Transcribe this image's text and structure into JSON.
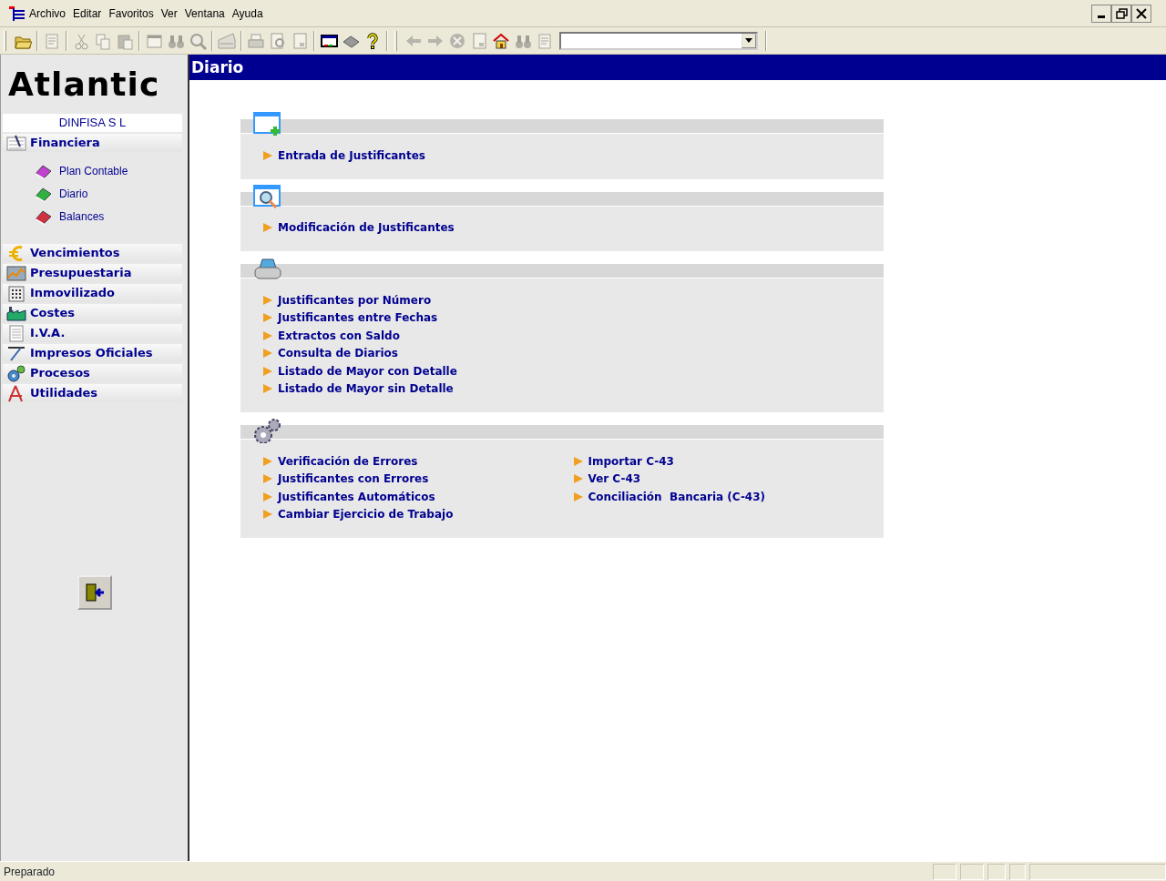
{
  "menu": [
    {
      "label": "Archivo"
    },
    {
      "label": "Editar"
    },
    {
      "label": "Favoritos"
    },
    {
      "label": "Ver"
    },
    {
      "label": "Ventana"
    },
    {
      "label": "Ayuda"
    }
  ],
  "toolbar": [
    [
      {
        "disabled": false
      }
    ],
    [
      {
        "disabled": true
      }
    ],
    [
      {
        "disabled": true
      },
      {
        "disabled": true
      },
      {
        "disabled": true
      }
    ],
    [
      {
        "disabled": true
      },
      {
        "disabled": true
      },
      {
        "disabled": true
      }
    ],
    [
      {
        "disabled": true
      }
    ],
    [
      {
        "disabled": true
      },
      {
        "disabled": true
      },
      {
        "disabled": true
      }
    ],
    [
      {
        "disabled": false
      },
      {
        "disabled": false
      },
      {
        "disabled": false
      }
    ],
    [
      {
        "disabled": true
      },
      {
        "disabled": true
      },
      {
        "disabled": true
      },
      {
        "disabled": true
      },
      {
        "disabled": false
      },
      {
        "disabled": true
      },
      {
        "disabled": true
      }
    ]
  ],
  "sidebar": {
    "logo": "Atlantic",
    "company": "DINFISA  S L",
    "modules": [
      {
        "label": "Financiera",
        "children": [
          {
            "label": "Plan Contable",
            "color": "#c040d0"
          },
          {
            "label": "Diario",
            "color": "#30b040"
          },
          {
            "label": "Balances",
            "color": "#d03040"
          }
        ]
      },
      {
        "label": "Vencimientos"
      },
      {
        "label": "Presupuestaria"
      },
      {
        "label": "Inmovilizado"
      },
      {
        "label": "Costes"
      },
      {
        "label": "I.V.A."
      },
      {
        "label": "Impresos Oficiales"
      },
      {
        "label": "Procesos"
      },
      {
        "label": "Utilidades"
      }
    ]
  },
  "content": {
    "title": "Diario",
    "sections": [
      {
        "columns": [
          [
            "Entrada de Justificantes"
          ]
        ]
      },
      {
        "columns": [
          [
            "Modificación de Justificantes"
          ]
        ]
      },
      {
        "columns": [
          [
            "Justificantes por Número",
            "Justificantes entre Fechas",
            "Extractos con Saldo",
            "Consulta de Diarios",
            "Listado de Mayor con Detalle",
            "Listado de Mayor sin Detalle"
          ]
        ]
      },
      {
        "columns": [
          [
            "Verificación de Errores",
            "Justificantes con Errores",
            "Justificantes Automáticos",
            "Cambiar Ejercicio de Trabajo"
          ],
          [
            "Importar C-43",
            "Ver C-43",
            "Conciliación  Bancaria (C-43)"
          ]
        ]
      }
    ]
  },
  "status_bar": {
    "text": "Preparado"
  }
}
